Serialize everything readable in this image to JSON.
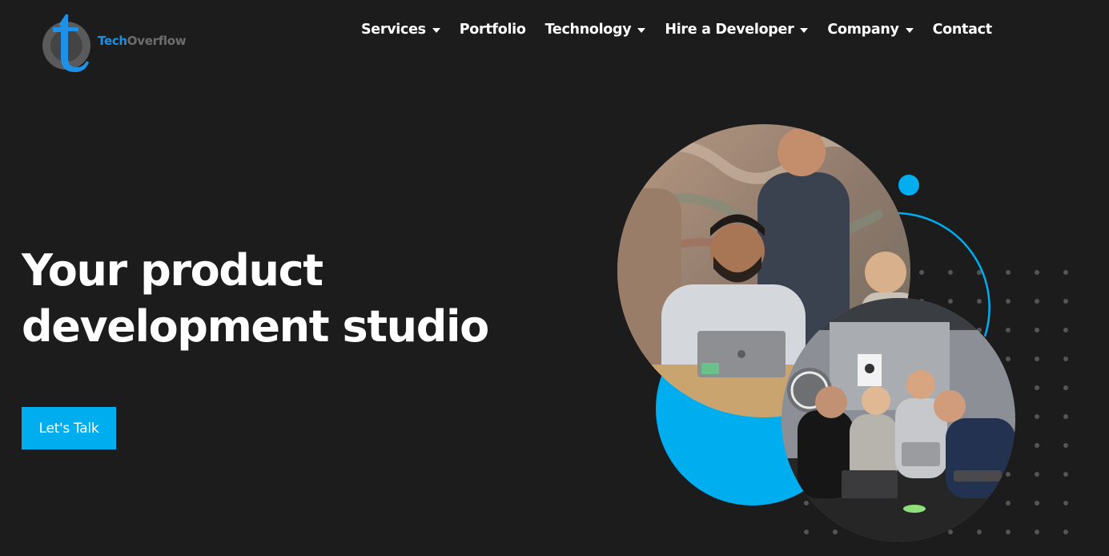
{
  "brand": {
    "name_part1": "Tech",
    "name_part2": "Overflow",
    "logo_letter": "t",
    "colors": {
      "blue": "#1e90e6",
      "gray": "#6d6d6d"
    }
  },
  "nav": {
    "items": [
      {
        "label": "Services",
        "dropdown": true
      },
      {
        "label": "Portfolio",
        "dropdown": false
      },
      {
        "label": "Technology",
        "dropdown": true
      },
      {
        "label": "Hire a Developer",
        "dropdown": true
      },
      {
        "label": "Company",
        "dropdown": true
      },
      {
        "label": "Contact",
        "dropdown": false
      }
    ]
  },
  "hero": {
    "headline_line1": "Your product",
    "headline_line2": "development studio",
    "cta_label": "Let's Talk"
  },
  "theme": {
    "background": "#1c1c1d",
    "accent": "#00aef0",
    "text": "#ffffff",
    "dot_color": "#555555"
  },
  "images": {
    "photo_top": "team-around-laptop-photo",
    "photo_bottom": "team-meeting-room-photo"
  }
}
